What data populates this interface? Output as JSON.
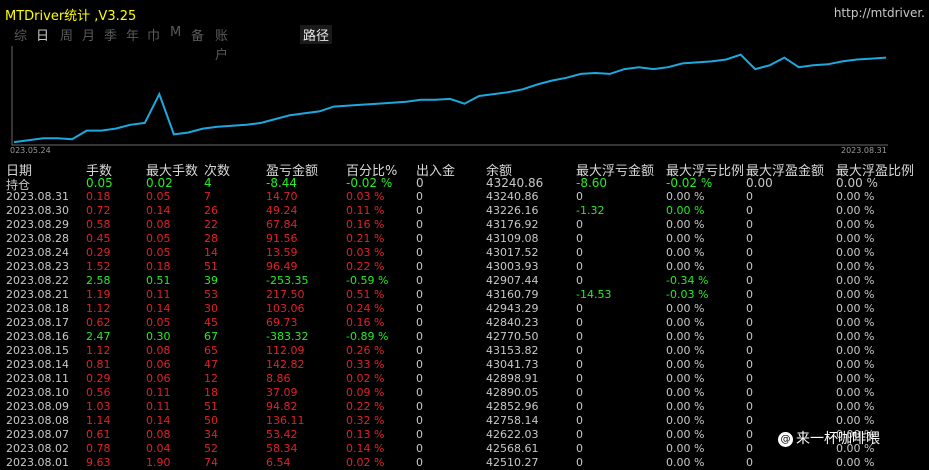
{
  "header": {
    "title": "MTDriver统计 ,V3.25",
    "url": "http://mtdriver."
  },
  "tabs": [
    "综",
    "日",
    "周",
    "月",
    "季",
    "年",
    "巾",
    "M",
    "备",
    "账户"
  ],
  "active_tab_index": 1,
  "path_label": "路径",
  "chart": {
    "start_label": "023.05.24",
    "end_label": "2023.08.31",
    "line_color": "#1ea8e0",
    "values": [
      0.02,
      0.04,
      0.06,
      0.06,
      0.05,
      0.14,
      0.14,
      0.16,
      0.2,
      0.22,
      0.52,
      0.1,
      0.12,
      0.16,
      0.18,
      0.19,
      0.2,
      0.22,
      0.26,
      0.3,
      0.32,
      0.34,
      0.39,
      0.4,
      0.41,
      0.42,
      0.43,
      0.44,
      0.46,
      0.46,
      0.47,
      0.42,
      0.5,
      0.52,
      0.54,
      0.57,
      0.62,
      0.66,
      0.69,
      0.73,
      0.74,
      0.73,
      0.78,
      0.8,
      0.78,
      0.8,
      0.84,
      0.85,
      0.86,
      0.88,
      0.93,
      0.78,
      0.82,
      0.9,
      0.8,
      0.82,
      0.83,
      0.86,
      0.88,
      0.89,
      0.9
    ]
  },
  "columns": [
    "日期",
    "手数",
    "最大手数",
    "次数",
    "盈亏金额",
    "百分比%",
    "出入金",
    "余额",
    "最大浮亏金额",
    "最大浮亏比例",
    "最大浮盈金额",
    "最大浮盈比例"
  ],
  "rows": [
    {
      "date": "持仓",
      "lots": "0.05",
      "max_lots": "0.02",
      "count": "4",
      "pnl": "-8.44",
      "pct": "-0.02 %",
      "inout": "0",
      "balance": "43240.86",
      "mfl_amt": "-8.60",
      "mfl_pct": "-0.02 %",
      "mfp_amt": "0.00",
      "mfp_pct": "0.00 %",
      "c": "g",
      "mfl_c": "g"
    },
    {
      "date": "2023.08.31",
      "lots": "0.18",
      "max_lots": "0.05",
      "count": "7",
      "pnl": "14.70",
      "pct": "0.03 %",
      "inout": "0",
      "balance": "43240.86",
      "mfl_amt": "0",
      "mfl_pct": "0.00 %",
      "mfp_amt": "0",
      "mfp_pct": "0.00 %",
      "c": "r",
      "mfl_c": "w"
    },
    {
      "date": "2023.08.30",
      "lots": "0.72",
      "max_lots": "0.14",
      "count": "26",
      "pnl": "49.24",
      "pct": "0.11 %",
      "inout": "0",
      "balance": "43226.16",
      "mfl_amt": "-1.32",
      "mfl_pct": "0.00 %",
      "mfp_amt": "0",
      "mfp_pct": "0.00 %",
      "c": "r",
      "mfl_c": "g"
    },
    {
      "date": "2023.08.29",
      "lots": "0.58",
      "max_lots": "0.08",
      "count": "22",
      "pnl": "67.84",
      "pct": "0.16 %",
      "inout": "0",
      "balance": "43176.92",
      "mfl_amt": "0",
      "mfl_pct": "0.00 %",
      "mfp_amt": "0",
      "mfp_pct": "0.00 %",
      "c": "r",
      "mfl_c": "w"
    },
    {
      "date": "2023.08.28",
      "lots": "0.45",
      "max_lots": "0.05",
      "count": "28",
      "pnl": "91.56",
      "pct": "0.21 %",
      "inout": "0",
      "balance": "43109.08",
      "mfl_amt": "0",
      "mfl_pct": "0.00 %",
      "mfp_amt": "0",
      "mfp_pct": "0.00 %",
      "c": "r",
      "mfl_c": "w"
    },
    {
      "date": "2023.08.24",
      "lots": "0.29",
      "max_lots": "0.05",
      "count": "14",
      "pnl": "13.59",
      "pct": "0.03 %",
      "inout": "0",
      "balance": "43017.52",
      "mfl_amt": "0",
      "mfl_pct": "0.00 %",
      "mfp_amt": "0",
      "mfp_pct": "0.00 %",
      "c": "r",
      "mfl_c": "w"
    },
    {
      "date": "2023.08.23",
      "lots": "1.52",
      "max_lots": "0.18",
      "count": "51",
      "pnl": "96.49",
      "pct": "0.22 %",
      "inout": "0",
      "balance": "43003.93",
      "mfl_amt": "0",
      "mfl_pct": "0.00 %",
      "mfp_amt": "0",
      "mfp_pct": "0.00 %",
      "c": "r",
      "mfl_c": "w"
    },
    {
      "date": "2023.08.22",
      "lots": "2.58",
      "max_lots": "0.51",
      "count": "39",
      "pnl": "-253.35",
      "pct": "-0.59 %",
      "inout": "0",
      "balance": "42907.44",
      "mfl_amt": "0",
      "mfl_pct": "-0.34 %",
      "mfp_amt": "0",
      "mfp_pct": "0.00 %",
      "c": "g",
      "mfl_c": "w",
      "mflp_c": "g"
    },
    {
      "date": "2023.08.21",
      "lots": "1.19",
      "max_lots": "0.11",
      "count": "53",
      "pnl": "217.50",
      "pct": "0.51 %",
      "inout": "0",
      "balance": "43160.79",
      "mfl_amt": "-14.53",
      "mfl_pct": "-0.03 %",
      "mfp_amt": "0",
      "mfp_pct": "0.00 %",
      "c": "r",
      "mfl_c": "g"
    },
    {
      "date": "2023.08.18",
      "lots": "1.12",
      "max_lots": "0.14",
      "count": "30",
      "pnl": "103.06",
      "pct": "0.24 %",
      "inout": "0",
      "balance": "42943.29",
      "mfl_amt": "0",
      "mfl_pct": "0.00 %",
      "mfp_amt": "0",
      "mfp_pct": "0.00 %",
      "c": "r",
      "mfl_c": "w"
    },
    {
      "date": "2023.08.17",
      "lots": "0.62",
      "max_lots": "0.05",
      "count": "45",
      "pnl": "69.73",
      "pct": "0.16 %",
      "inout": "0",
      "balance": "42840.23",
      "mfl_amt": "0",
      "mfl_pct": "0.00 %",
      "mfp_amt": "0",
      "mfp_pct": "0.00 %",
      "c": "r",
      "mfl_c": "w"
    },
    {
      "date": "2023.08.16",
      "lots": "2.47",
      "max_lots": "0.30",
      "count": "67",
      "pnl": "-383.32",
      "pct": "-0.89 %",
      "inout": "0",
      "balance": "42770.50",
      "mfl_amt": "0",
      "mfl_pct": "0.00 %",
      "mfp_amt": "0",
      "mfp_pct": "0.00 %",
      "c": "g",
      "mfl_c": "w"
    },
    {
      "date": "2023.08.15",
      "lots": "1.12",
      "max_lots": "0.08",
      "count": "65",
      "pnl": "112.09",
      "pct": "0.26 %",
      "inout": "0",
      "balance": "43153.82",
      "mfl_amt": "0",
      "mfl_pct": "0.00 %",
      "mfp_amt": "0",
      "mfp_pct": "0.00 %",
      "c": "r",
      "mfl_c": "w"
    },
    {
      "date": "2023.08.14",
      "lots": "0.81",
      "max_lots": "0.06",
      "count": "47",
      "pnl": "142.82",
      "pct": "0.33 %",
      "inout": "0",
      "balance": "43041.73",
      "mfl_amt": "0",
      "mfl_pct": "0.00 %",
      "mfp_amt": "0",
      "mfp_pct": "0.00 %",
      "c": "r",
      "mfl_c": "w"
    },
    {
      "date": "2023.08.11",
      "lots": "0.29",
      "max_lots": "0.06",
      "count": "12",
      "pnl": "8.86",
      "pct": "0.02 %",
      "inout": "0",
      "balance": "42898.91",
      "mfl_amt": "0",
      "mfl_pct": "0.00 %",
      "mfp_amt": "0",
      "mfp_pct": "0.00 %",
      "c": "r",
      "mfl_c": "w"
    },
    {
      "date": "2023.08.10",
      "lots": "0.56",
      "max_lots": "0.11",
      "count": "18",
      "pnl": "37.09",
      "pct": "0.09 %",
      "inout": "0",
      "balance": "42890.05",
      "mfl_amt": "0",
      "mfl_pct": "0.00 %",
      "mfp_amt": "0",
      "mfp_pct": "0.00 %",
      "c": "r",
      "mfl_c": "w"
    },
    {
      "date": "2023.08.09",
      "lots": "1.03",
      "max_lots": "0.11",
      "count": "51",
      "pnl": "94.82",
      "pct": "0.22 %",
      "inout": "0",
      "balance": "42852.96",
      "mfl_amt": "0",
      "mfl_pct": "0.00 %",
      "mfp_amt": "0",
      "mfp_pct": "0.00 %",
      "c": "r",
      "mfl_c": "w"
    },
    {
      "date": "2023.08.08",
      "lots": "1.14",
      "max_lots": "0.14",
      "count": "50",
      "pnl": "136.11",
      "pct": "0.32 %",
      "inout": "0",
      "balance": "42758.14",
      "mfl_amt": "0",
      "mfl_pct": "0.00 %",
      "mfp_amt": "0",
      "mfp_pct": "0.00 %",
      "c": "r",
      "mfl_c": "w"
    },
    {
      "date": "2023.08.07",
      "lots": "0.61",
      "max_lots": "0.08",
      "count": "34",
      "pnl": "53.42",
      "pct": "0.13 %",
      "inout": "0",
      "balance": "42622.03",
      "mfl_amt": "0",
      "mfl_pct": "0.00 %",
      "mfp_amt": "0",
      "mfp_pct": "0.00 %",
      "c": "r",
      "mfl_c": "w"
    },
    {
      "date": "2023.08.02",
      "lots": "0.78",
      "max_lots": "0.04",
      "count": "52",
      "pnl": "58.34",
      "pct": "0.14 %",
      "inout": "0",
      "balance": "42568.61",
      "mfl_amt": "0",
      "mfl_pct": "0.00 %",
      "mfp_amt": "0",
      "mfp_pct": "0.00 %",
      "c": "r",
      "mfl_c": "w"
    },
    {
      "date": "2023.08.01",
      "lots": "9.63",
      "max_lots": "1.90",
      "count": "74",
      "pnl": "6.54",
      "pct": "0.02 %",
      "inout": "0",
      "balance": "42510.27",
      "mfl_amt": "0",
      "mfl_pct": "0.00 %",
      "mfp_amt": "0",
      "mfp_pct": "0.00 %",
      "c": "r",
      "mfl_c": "w"
    }
  ],
  "watermark": {
    "icon": "zhihu-icon",
    "icon_glyph": "@",
    "text": "来一杯咖啡喂"
  }
}
